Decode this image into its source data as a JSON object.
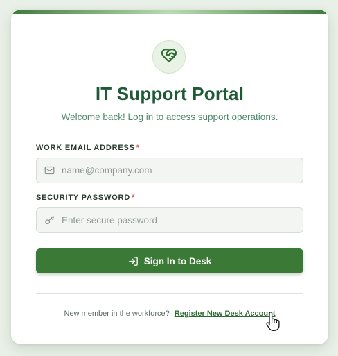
{
  "app": {
    "title": "IT Support Portal",
    "subtitle": "Welcome back! Log in to access support operations."
  },
  "form": {
    "email": {
      "label": "WORK EMAIL ADDRESS",
      "required_mark": "*",
      "placeholder": "name@company.com",
      "value": "",
      "icon": "mail-icon"
    },
    "password": {
      "label": "SECURITY PASSWORD",
      "required_mark": "*",
      "placeholder": "Enter secure password",
      "value": "",
      "icon": "key-icon"
    },
    "submit_label": "Sign In to Desk",
    "submit_icon": "login-icon"
  },
  "footer": {
    "prompt": "New member in the workforce?",
    "register_link": "Register New Desk Account"
  },
  "colors": {
    "accent": "#3b7a36",
    "title": "#1f5a37",
    "subtitle": "#4f8a6d",
    "required": "#d23c3c"
  },
  "logo_icon": "heart-handshake-icon"
}
